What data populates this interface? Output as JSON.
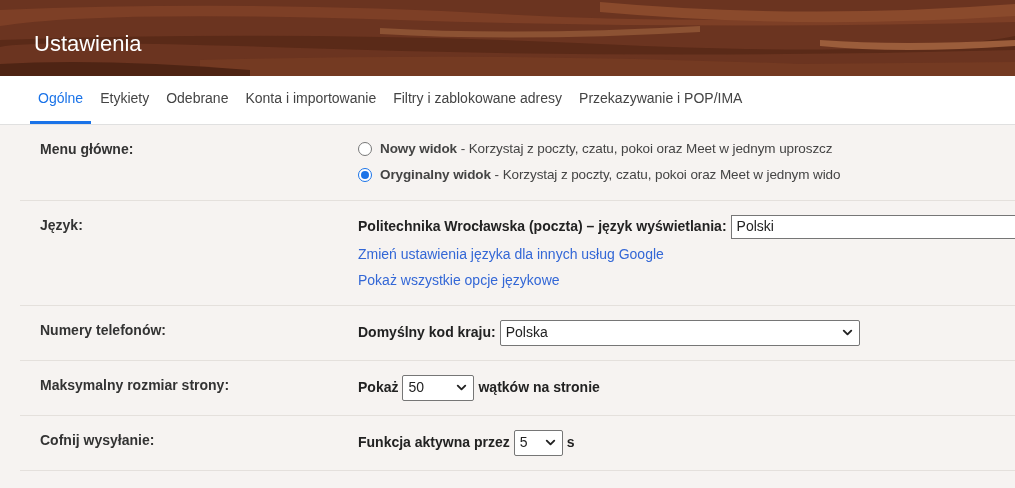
{
  "header": {
    "title": "Ustawienia"
  },
  "tabs": [
    {
      "label": "Ogólne",
      "selected": true
    },
    {
      "label": "Etykiety",
      "selected": false
    },
    {
      "label": "Odebrane",
      "selected": false
    },
    {
      "label": "Konta i importowanie",
      "selected": false
    },
    {
      "label": "Filtry i zablokowane adresy",
      "selected": false
    },
    {
      "label": "Przekazywanie i POP/IMA",
      "selected": false
    }
  ],
  "settings": [
    {
      "kind": "radios",
      "label": "Menu główne:",
      "options": [
        {
          "text": "**Nowy widok** - Korzystaj z poczty, czatu, pokoi oraz Meet w jednym uproszcz",
          "selected": false
        },
        {
          "text": "**Oryginalny widok** - Korzystaj z poczty, czatu, pokoi oraz Meet w jednym wido",
          "selected": true
        }
      ]
    },
    {
      "kind": "language",
      "label": "Język:",
      "prefix": "Politechnika Wrocławska (poczta) – język wyświetlania:",
      "value": "Polski",
      "links": [
        "Zmień ustawienia języka dla innych usług Google",
        "Pokaż wszystkie opcje językowe"
      ]
    },
    {
      "kind": "select",
      "label": "Numery telefonów:",
      "prefix": "Domyślny kod kraju:",
      "value": "Polska"
    },
    {
      "kind": "select",
      "label": "Maksymalny rozmiar strony:",
      "prefix": "Pokaż",
      "value": "50",
      "suffix": "wątków na stronie"
    },
    {
      "kind": "select",
      "label": "Cofnij wysyłanie:",
      "prefix": "Funkcja aktywna przez",
      "value": "5",
      "suffix": "s"
    }
  ]
}
